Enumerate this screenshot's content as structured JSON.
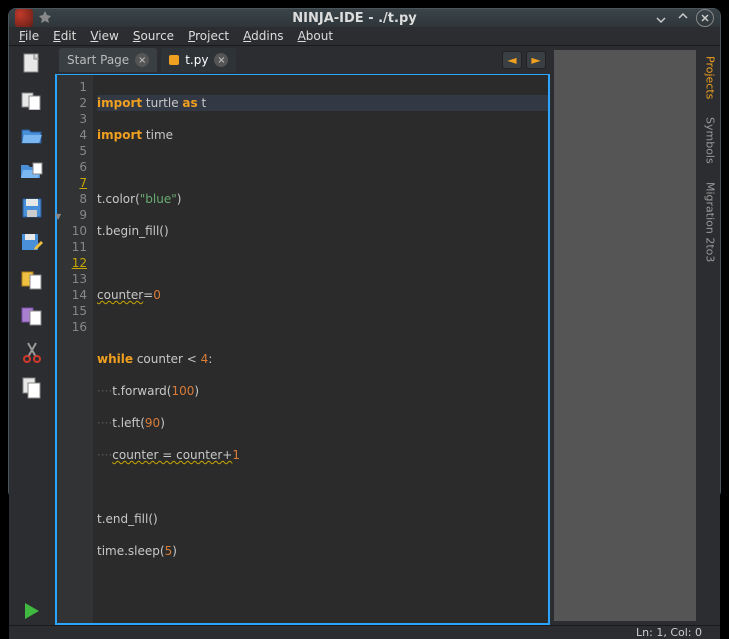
{
  "window": {
    "title": "NINJA-IDE - ./t.py"
  },
  "menu": {
    "file": "File",
    "edit": "Edit",
    "view": "View",
    "source": "Source",
    "project": "Project",
    "addins": "Addins",
    "about": "About"
  },
  "tabs": {
    "startpage": {
      "label": "Start Page"
    },
    "file": {
      "label": "t.py"
    }
  },
  "sidepanel": {
    "projects": "Projects",
    "symbols": "Symbols",
    "migration": "Migration 2to3"
  },
  "status": {
    "pos": "Ln: 1, Col: 0"
  },
  "code": {
    "l1a": "import",
    "l1b": " turtle ",
    "l1c": "as",
    "l1d": " t",
    "l2a": "import",
    "l2b": " time",
    "l3": "",
    "l4a": "t.color(",
    "l4b": "\"blue\"",
    "l4c": ")",
    "l5": "t.begin_fill()",
    "l6": "",
    "l7a": "counter",
    "l7b": "=",
    "l7c": "0",
    "l8": "",
    "l9a": "while",
    "l9b": " counter < ",
    "l9c": "4",
    "l9d": ":",
    "l10a": "····",
    "l10b": "t.forward(",
    "l10c": "100",
    "l10d": ")",
    "l11a": "····",
    "l11b": "t.left(",
    "l11c": "90",
    "l11d": ")",
    "l12a": "····",
    "l12b": "counter = counter+",
    "l12c": "1",
    "l13": "",
    "l14": "t.end_fill()",
    "l15a": "time.sleep(",
    "l15b": "5",
    "l15c": ")",
    "l16": ""
  },
  "gutter": [
    "1",
    "2",
    "3",
    "4",
    "5",
    "6",
    "7",
    "8",
    "9",
    "10",
    "11",
    "12",
    "13",
    "14",
    "15",
    "16"
  ]
}
